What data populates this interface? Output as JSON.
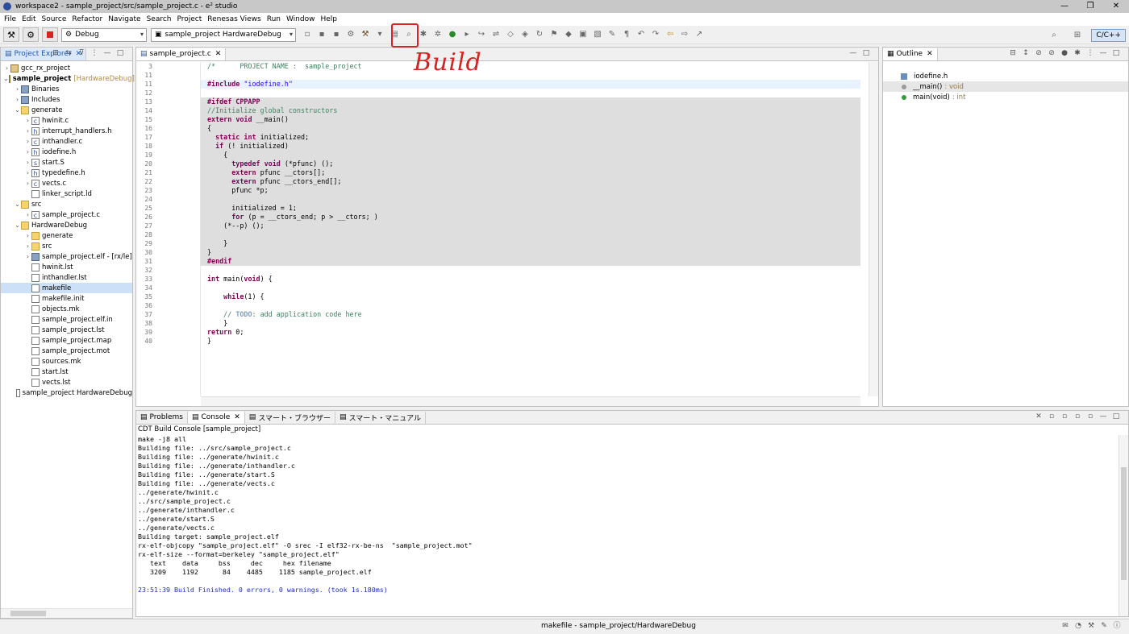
{
  "window": {
    "title": "workspace2 - sample_project/src/sample_project.c - e² studio",
    "min": "—",
    "max": "❐",
    "close": "✕"
  },
  "menu": [
    "File",
    "Edit",
    "Source",
    "Refactor",
    "Navigate",
    "Search",
    "Project",
    "Renesas Views",
    "Run",
    "Window",
    "Help"
  ],
  "toolbar": {
    "build_config": "Debug",
    "launch_config": "sample_project HardwareDebug",
    "perspective": "C/C++"
  },
  "annotation": {
    "label": "Build",
    "color": "#d62323"
  },
  "project_explorer": {
    "tab": "Project Explorer",
    "rows": [
      {
        "indent": 0,
        "twisty": ">",
        "icon": "proj",
        "label": "gcc_rx_project",
        "extra": ""
      },
      {
        "indent": 0,
        "twisty": "v",
        "icon": "proj",
        "label": "sample_project",
        "extra": "[HardwareDebug]",
        "bold": true
      },
      {
        "indent": 1,
        "twisty": ">",
        "icon": "bin",
        "label": "Binaries",
        "extra": ""
      },
      {
        "indent": 1,
        "twisty": ">",
        "icon": "bin",
        "label": "Includes",
        "extra": ""
      },
      {
        "indent": 1,
        "twisty": "v",
        "icon": "folder",
        "label": "generate",
        "extra": ""
      },
      {
        "indent": 2,
        "twisty": ">",
        "icon": "c",
        "label": "hwinit.c",
        "extra": ""
      },
      {
        "indent": 2,
        "twisty": ">",
        "icon": "h",
        "label": "interrupt_handlers.h",
        "extra": ""
      },
      {
        "indent": 2,
        "twisty": ">",
        "icon": "c",
        "label": "inthandler.c",
        "extra": ""
      },
      {
        "indent": 2,
        "twisty": ">",
        "icon": "h",
        "label": "iodefine.h",
        "extra": ""
      },
      {
        "indent": 2,
        "twisty": ">",
        "icon": "s",
        "label": "start.S",
        "extra": ""
      },
      {
        "indent": 2,
        "twisty": ">",
        "icon": "h",
        "label": "typedefine.h",
        "extra": ""
      },
      {
        "indent": 2,
        "twisty": ">",
        "icon": "c",
        "label": "vects.c",
        "extra": ""
      },
      {
        "indent": 2,
        "twisty": "",
        "icon": "file",
        "label": "linker_script.ld",
        "extra": ""
      },
      {
        "indent": 1,
        "twisty": "v",
        "icon": "folder",
        "label": "src",
        "extra": ""
      },
      {
        "indent": 2,
        "twisty": ">",
        "icon": "c",
        "label": "sample_project.c",
        "extra": ""
      },
      {
        "indent": 1,
        "twisty": "v",
        "icon": "folder",
        "label": "HardwareDebug",
        "extra": ""
      },
      {
        "indent": 2,
        "twisty": ">",
        "icon": "folder",
        "label": "generate",
        "extra": ""
      },
      {
        "indent": 2,
        "twisty": ">",
        "icon": "folder",
        "label": "src",
        "extra": ""
      },
      {
        "indent": 2,
        "twisty": ">",
        "icon": "bin",
        "label": "sample_project.elf - [rx/le]",
        "extra": ""
      },
      {
        "indent": 2,
        "twisty": "",
        "icon": "file",
        "label": "hwinit.lst",
        "extra": ""
      },
      {
        "indent": 2,
        "twisty": "",
        "icon": "file",
        "label": "inthandler.lst",
        "extra": ""
      },
      {
        "indent": 2,
        "twisty": "",
        "icon": "file",
        "label": "makefile",
        "extra": "",
        "selected": true
      },
      {
        "indent": 2,
        "twisty": "",
        "icon": "file",
        "label": "makefile.init",
        "extra": ""
      },
      {
        "indent": 2,
        "twisty": "",
        "icon": "file",
        "label": "objects.mk",
        "extra": ""
      },
      {
        "indent": 2,
        "twisty": "",
        "icon": "file",
        "label": "sample_project.elf.in",
        "extra": ""
      },
      {
        "indent": 2,
        "twisty": "",
        "icon": "file",
        "label": "sample_project.lst",
        "extra": ""
      },
      {
        "indent": 2,
        "twisty": "",
        "icon": "file",
        "label": "sample_project.map",
        "extra": ""
      },
      {
        "indent": 2,
        "twisty": "",
        "icon": "file",
        "label": "sample_project.mot",
        "extra": ""
      },
      {
        "indent": 2,
        "twisty": "",
        "icon": "file",
        "label": "sources.mk",
        "extra": ""
      },
      {
        "indent": 2,
        "twisty": "",
        "icon": "file",
        "label": "start.lst",
        "extra": ""
      },
      {
        "indent": 2,
        "twisty": "",
        "icon": "file",
        "label": "vects.lst",
        "extra": ""
      },
      {
        "indent": 1,
        "twisty": "",
        "icon": "file",
        "label": "sample_project HardwareDebug",
        "extra": ""
      }
    ]
  },
  "editor": {
    "tab": "sample_project.c",
    "lines": [
      {
        "n": "3",
        "text": "/*      PROJECT NAME :  sample_project",
        "cls": "com",
        "bg": ""
      },
      {
        "n": "11",
        "text": "",
        "cls": "",
        "bg": ""
      },
      {
        "n": "11",
        "text": "#include \"iodefine.h\"",
        "cls": "inc",
        "bg": "hl"
      },
      {
        "n": "12",
        "text": "",
        "cls": "",
        "bg": ""
      },
      {
        "n": "13",
        "text": "#ifdef CPPAPP",
        "cls": "kw",
        "bg": "grey"
      },
      {
        "n": "14",
        "text": "//Initialize global constructors",
        "cls": "com",
        "bg": "grey"
      },
      {
        "n": "15",
        "text": "extern void __main()",
        "cls": "ext",
        "bg": "grey"
      },
      {
        "n": "16",
        "text": "{",
        "cls": "",
        "bg": "grey"
      },
      {
        "n": "17",
        "text": "  static int initialized;",
        "cls": "st",
        "bg": "grey"
      },
      {
        "n": "18",
        "text": "  if (! initialized)",
        "cls": "if",
        "bg": "grey"
      },
      {
        "n": "19",
        "text": "    {",
        "cls": "",
        "bg": "grey"
      },
      {
        "n": "20",
        "text": "      typedef void (*pfunc) ();",
        "cls": "td",
        "bg": "grey"
      },
      {
        "n": "21",
        "text": "      extern pfunc __ctors[];",
        "cls": "ex2",
        "bg": "grey"
      },
      {
        "n": "22",
        "text": "      extern pfunc __ctors_end[];",
        "cls": "ex2",
        "bg": "grey"
      },
      {
        "n": "23",
        "text": "      pfunc *p;",
        "cls": "",
        "bg": "grey"
      },
      {
        "n": "24",
        "text": "",
        "cls": "",
        "bg": "grey"
      },
      {
        "n": "25",
        "text": "      initialized = 1;",
        "cls": "",
        "bg": "grey"
      },
      {
        "n": "26",
        "text": "      for (p = __ctors_end; p > __ctors; )",
        "cls": "for",
        "bg": "grey"
      },
      {
        "n": "27",
        "text": "    (*--p) ();",
        "cls": "",
        "bg": "grey"
      },
      {
        "n": "28",
        "text": "",
        "cls": "",
        "bg": "grey"
      },
      {
        "n": "29",
        "text": "    }",
        "cls": "",
        "bg": "grey"
      },
      {
        "n": "30",
        "text": "}",
        "cls": "",
        "bg": "grey"
      },
      {
        "n": "31",
        "text": "#endif",
        "cls": "kw",
        "bg": "grey"
      },
      {
        "n": "32",
        "text": "",
        "cls": "",
        "bg": ""
      },
      {
        "n": "33",
        "text": "int main(void) {",
        "cls": "main",
        "bg": ""
      },
      {
        "n": "34",
        "text": "",
        "cls": "",
        "bg": ""
      },
      {
        "n": "35",
        "text": "    while(1) {",
        "cls": "while",
        "bg": ""
      },
      {
        "n": "36",
        "text": "",
        "cls": "",
        "bg": ""
      },
      {
        "n": "37",
        "text": "    // TODO: add application code here",
        "cls": "todo",
        "bg": ""
      },
      {
        "n": "38",
        "text": "    }",
        "cls": "",
        "bg": ""
      },
      {
        "n": "39",
        "text": "return 0;",
        "cls": "ret",
        "bg": ""
      },
      {
        "n": "40",
        "text": "}",
        "cls": "",
        "bg": ""
      }
    ]
  },
  "outline": {
    "tab": "Outline",
    "items": [
      {
        "icon": "inc",
        "label": "iodefine.h",
        "type": ""
      },
      {
        "icon": "fn",
        "label": "__main()",
        "type": ": void",
        "selected": true
      },
      {
        "icon": "dot",
        "label": "main(void)",
        "type": ": int"
      }
    ]
  },
  "console": {
    "tabs": [
      "Problems",
      "Console",
      "スマート・ブラウザー",
      "スマート・マニュアル"
    ],
    "active_tab": 1,
    "title": "CDT Build Console [sample_project]",
    "lines": [
      "make -j8 all",
      "Building file: ../src/sample_project.c",
      "Building file: ../generate/hwinit.c",
      "Building file: ../generate/inthandler.c",
      "Building file: ../generate/start.S",
      "Building file: ../generate/vects.c",
      "../generate/hwinit.c",
      "../src/sample_project.c",
      "../generate/inthandler.c",
      "../generate/start.S",
      "../generate/vects.c",
      "Building target: sample_project.elf",
      "rx-elf-objcopy \"sample_project.elf\" -O srec -I elf32-rx-be-ns  \"sample_project.mot\"",
      "rx-elf-size --format=berkeley \"sample_project.elf\"",
      "   text    data     bss     dec     hex filename",
      "   3209    1192      84    4485    1185 sample_project.elf",
      "",
      "23:51:39 Build Finished. 0 errors, 0 warnings. (took 1s.180ms)"
    ]
  },
  "status": {
    "text": "makefile - sample_project/HardwareDebug"
  }
}
